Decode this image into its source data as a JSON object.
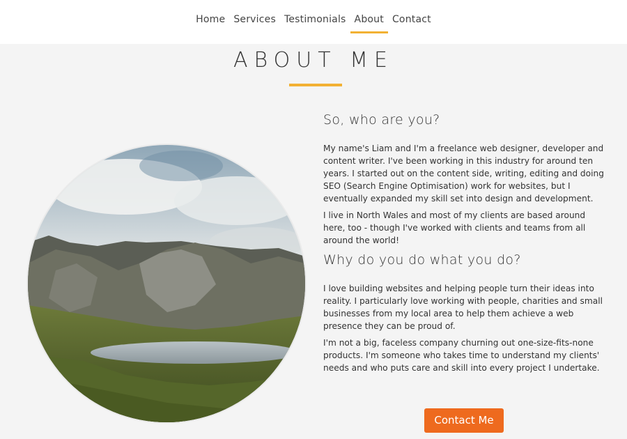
{
  "nav": {
    "items": [
      {
        "label": "Home"
      },
      {
        "label": "Services"
      },
      {
        "label": "Testimonials"
      },
      {
        "label": "About"
      },
      {
        "label": "Contact"
      }
    ],
    "active": "About"
  },
  "page": {
    "title": "ABOUT ME"
  },
  "sections": [
    {
      "heading": "So, who are you?",
      "paragraphs": [
        "My name's Liam and I'm a freelance web designer, developer and content writer. I've been working in this industry for around ten years. I started out on the content side, writing, editing and doing SEO (Search Engine Optimisation) work for websites, but I eventually expanded my skill set into design and development.",
        "I live in North Wales and most of my clients are based around here, too - though I've worked with clients and teams from all around the world!"
      ]
    },
    {
      "heading": "Why do you do what you do?",
      "paragraphs": [
        "I love building websites and helping people turn their ideas into reality. I particularly love working with people, charities and small businesses from my local area to help them achieve a web presence they can be proud of.",
        "I'm not a big, faceless company churning out one-size-fits-none products. I'm someone who takes time to understand my clients' needs and who puts care and skill into every project I undertake."
      ]
    }
  ],
  "cta": {
    "label": "Contact Me"
  },
  "colors": {
    "accent": "#f2b133",
    "button": "#ee6a1e",
    "background": "#f4f4f4"
  }
}
